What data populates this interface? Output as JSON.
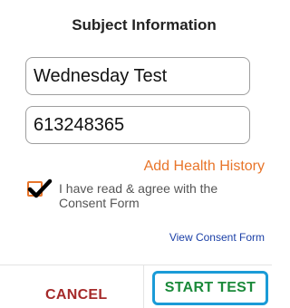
{
  "dialog": {
    "title": "Subject Information",
    "name_field": {
      "value": "Wednesday Test"
    },
    "id_field": {
      "value": "613248365"
    },
    "add_health_history_label": "Add Health History",
    "consent": {
      "checked": true,
      "text": "I have read & agree with the Consent Form"
    },
    "view_consent_label": "View Consent Form",
    "buttons": {
      "cancel_label": "CANCEL",
      "start_label": "START TEST"
    },
    "colors": {
      "accent_orange": "#e8752a",
      "cancel_red": "#a52a2a",
      "start_green": "#1b8a3a",
      "focus_blue": "#1a9bd7",
      "link_blue": "#1a3fa6"
    }
  }
}
